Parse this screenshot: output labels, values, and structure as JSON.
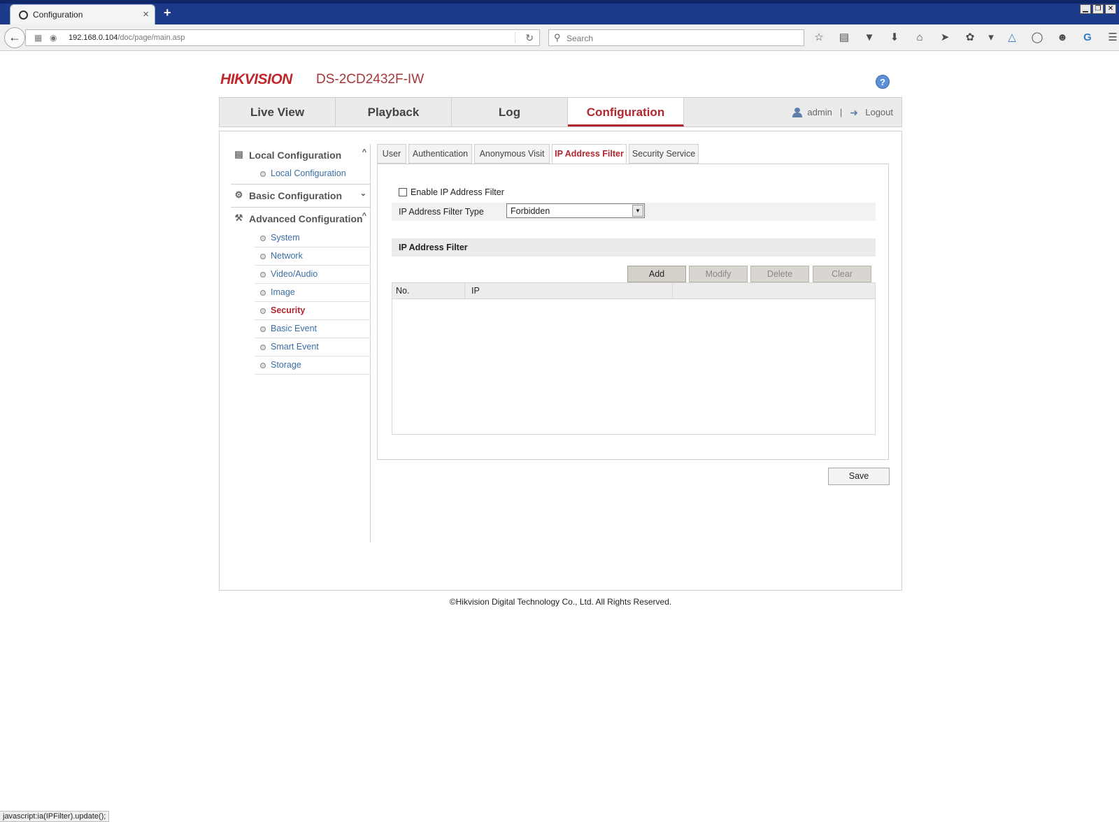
{
  "browser": {
    "tab_title": "Configuration",
    "tab_close": "×",
    "new_tab": "+",
    "url_host": "192.168.0.104",
    "url_path": "/doc/page/main.asp",
    "search_placeholder": "Search",
    "window_minimize": "▁",
    "window_restore": "❐",
    "window_close": "✕",
    "toolbar_icons": [
      "bookmark-star-icon",
      "reading-list-icon",
      "pocket-icon",
      "download-icon",
      "home-icon",
      "send-icon",
      "extension-icon",
      "dropdown-icon",
      "vpn-icon",
      "sync-icon",
      "chat-icon",
      "google-icon",
      "menu-icon"
    ],
    "status_text": "javascript:ia(IPFilter).update();"
  },
  "header": {
    "logo": "HIKVISION",
    "model": "DS-2CD2432F-IW",
    "help": "?"
  },
  "main_nav": {
    "items": [
      {
        "label": "Live View"
      },
      {
        "label": "Playback"
      },
      {
        "label": "Log"
      },
      {
        "label": "Configuration"
      }
    ],
    "active_index": 3,
    "user": "admin",
    "separator": "|",
    "logout": "Logout"
  },
  "sidebar": {
    "local": {
      "label": "Local Configuration",
      "arrow": "^",
      "items": [
        {
          "label": "Local Configuration"
        }
      ]
    },
    "basic": {
      "label": "Basic Configuration",
      "arrow": "⌄"
    },
    "advanced": {
      "label": "Advanced Configuration",
      "arrow": "^",
      "items": [
        {
          "label": "System"
        },
        {
          "label": "Network"
        },
        {
          "label": "Video/Audio"
        },
        {
          "label": "Image"
        },
        {
          "label": "Security"
        },
        {
          "label": "Basic Event"
        },
        {
          "label": "Smart Event"
        },
        {
          "label": "Storage"
        }
      ],
      "active_label": "Security"
    }
  },
  "sub_tabs": {
    "items": [
      {
        "label": "User"
      },
      {
        "label": "Authentication"
      },
      {
        "label": "Anonymous Visit"
      },
      {
        "label": "IP Address Filter"
      },
      {
        "label": "Security Service"
      }
    ],
    "active_index": 3
  },
  "ip_filter": {
    "enable_label": "Enable IP Address Filter",
    "enable_checked": false,
    "type_label": "IP Address Filter Type",
    "type_value": "Forbidden",
    "section_title": "IP Address Filter",
    "buttons": {
      "add": "Add",
      "modify": "Modify",
      "delete": "Delete",
      "clear": "Clear"
    },
    "table": {
      "columns": [
        "No.",
        "IP"
      ],
      "rows": []
    },
    "save": "Save"
  },
  "footer": {
    "copyright": "©Hikvision Digital Technology Co., Ltd. All Rights Reserved."
  }
}
